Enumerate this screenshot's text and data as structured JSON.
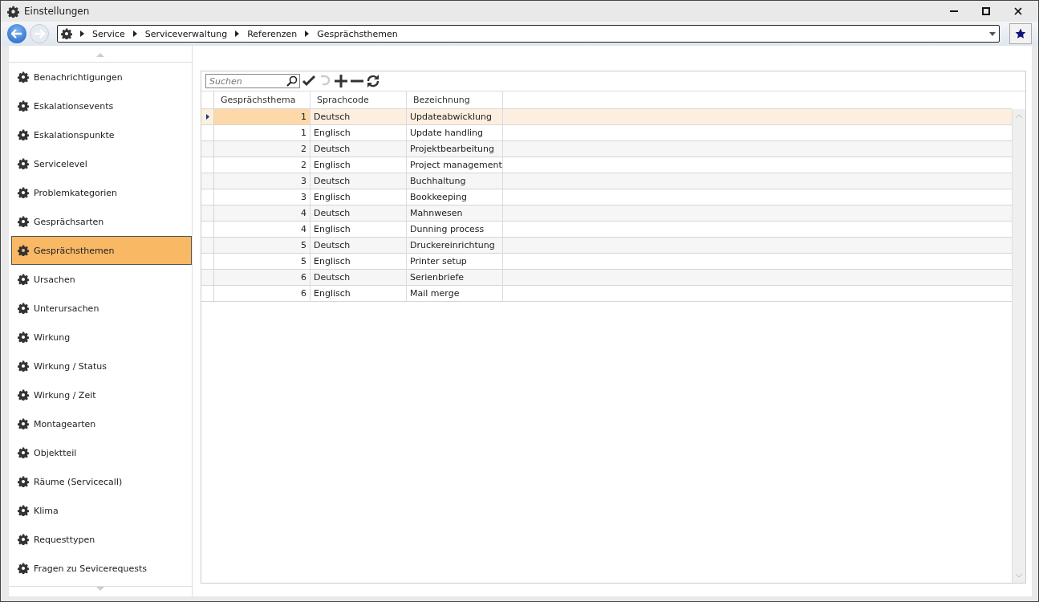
{
  "window": {
    "title": "Einstellungen"
  },
  "breadcrumb": [
    "Service",
    "Serviceverwaltung",
    "Referenzen",
    "Gesprächsthemen"
  ],
  "sidebar": {
    "items": [
      {
        "label": "Benachrichtigungen",
        "selected": false
      },
      {
        "label": "Eskalationsevents",
        "selected": false
      },
      {
        "label": "Eskalationspunkte",
        "selected": false
      },
      {
        "label": "Servicelevel",
        "selected": false
      },
      {
        "label": "Problemkategorien",
        "selected": false
      },
      {
        "label": "Gesprächsarten",
        "selected": false
      },
      {
        "label": "Gesprächsthemen",
        "selected": true
      },
      {
        "label": "Ursachen",
        "selected": false
      },
      {
        "label": "Unterursachen",
        "selected": false
      },
      {
        "label": "Wirkung",
        "selected": false
      },
      {
        "label": "Wirkung / Status",
        "selected": false
      },
      {
        "label": "Wirkung / Zeit",
        "selected": false
      },
      {
        "label": "Montagearten",
        "selected": false
      },
      {
        "label": "Objektteil",
        "selected": false
      },
      {
        "label": "Räume (Servicecall)",
        "selected": false
      },
      {
        "label": "Klima",
        "selected": false
      },
      {
        "label": "Requesttypen",
        "selected": false
      },
      {
        "label": "Fragen zu Sevicerequests",
        "selected": false
      }
    ]
  },
  "search": {
    "placeholder": "Suchen"
  },
  "table": {
    "columns": [
      "Gesprächsthema",
      "Sprachcode",
      "Bezeichnung"
    ],
    "rows": [
      {
        "cells": [
          "1",
          "Deutsch",
          "Updateabwicklung"
        ],
        "selected": true
      },
      {
        "cells": [
          "1",
          "Englisch",
          "Update handling"
        ],
        "selected": false
      },
      {
        "cells": [
          "2",
          "Deutsch",
          "Projektbearbeitung"
        ],
        "selected": false
      },
      {
        "cells": [
          "2",
          "Englisch",
          "Project management"
        ],
        "selected": false
      },
      {
        "cells": [
          "3",
          "Deutsch",
          "Buchhaltung"
        ],
        "selected": false
      },
      {
        "cells": [
          "3",
          "Englisch",
          "Bookkeeping"
        ],
        "selected": false
      },
      {
        "cells": [
          "4",
          "Deutsch",
          "Mahnwesen"
        ],
        "selected": false
      },
      {
        "cells": [
          "4",
          "Englisch",
          "Dunning process"
        ],
        "selected": false
      },
      {
        "cells": [
          "5",
          "Deutsch",
          "Druckereinrichtung"
        ],
        "selected": false
      },
      {
        "cells": [
          "5",
          "Englisch",
          "Printer setup"
        ],
        "selected": false
      },
      {
        "cells": [
          "6",
          "Deutsch",
          "Serienbriefe"
        ],
        "selected": false
      },
      {
        "cells": [
          "6",
          "Englisch",
          "Mail merge"
        ],
        "selected": false
      }
    ]
  }
}
